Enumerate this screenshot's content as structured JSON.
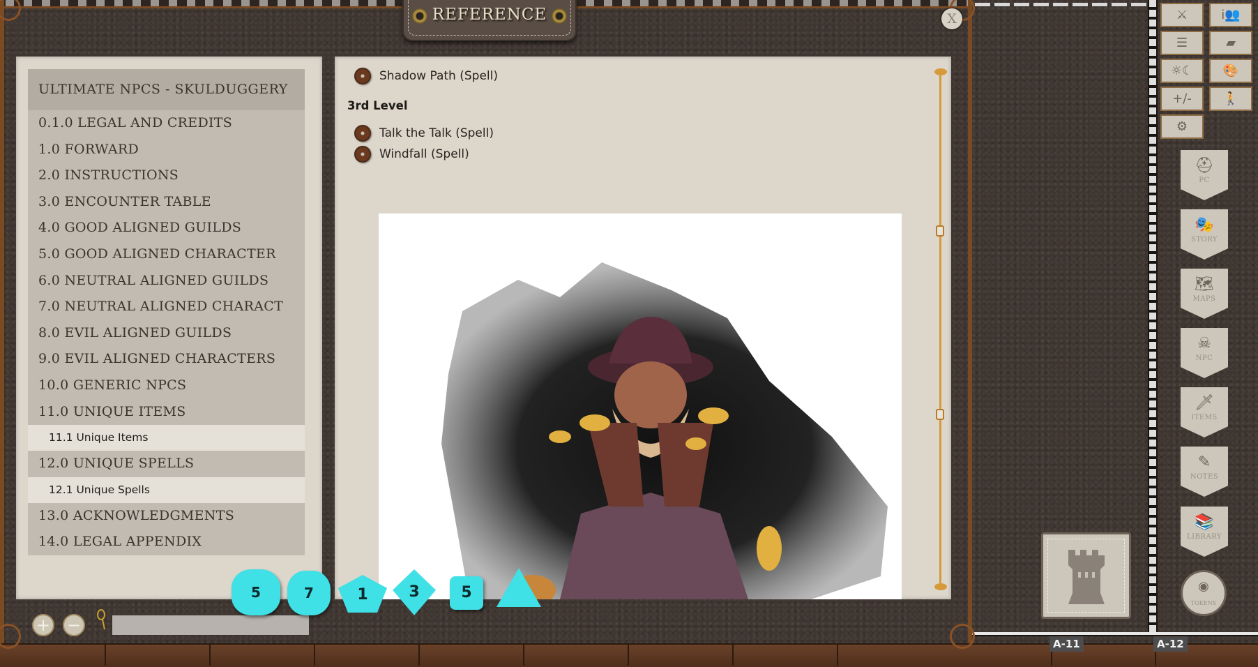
{
  "window": {
    "title": "REFERENCE",
    "close_label": "X"
  },
  "toc": {
    "header": "ULTIMATE NPCS - SKULDUGGERY",
    "chapters": [
      {
        "label": "0.1.0 LEGAL AND CREDITS"
      },
      {
        "label": "1.0 FORWARD"
      },
      {
        "label": "2.0 INSTRUCTIONS"
      },
      {
        "label": "3.0 ENCOUNTER TABLE"
      },
      {
        "label": "4.0 GOOD ALIGNED GUILDS"
      },
      {
        "label": "5.0 GOOD ALIGNED CHARACTER"
      },
      {
        "label": "6.0 NEUTRAL ALIGNED GUILDS"
      },
      {
        "label": "7.0 NEUTRAL ALIGNED CHARACT"
      },
      {
        "label": "8.0 EVIL ALIGNED GUILDS"
      },
      {
        "label": "9.0 EVIL ALIGNED CHARACTERS"
      },
      {
        "label": "10.0 GENERIC NPCS"
      },
      {
        "label": "11.0 UNIQUE ITEMS",
        "sub": "11.1 Unique Items"
      },
      {
        "label": "12.0 UNIQUE SPELLS",
        "sub": "12.1 Unique Spells"
      },
      {
        "label": "13.0 ACKNOWLEDGMENTS"
      },
      {
        "label": "14.0 LEGAL APPENDIX"
      }
    ]
  },
  "content": {
    "links_top": [
      {
        "label": "Shadow Path (Spell)",
        "icon": "link-icon"
      }
    ],
    "heading": "3rd Level",
    "links_bottom": [
      {
        "label": "Talk the Talk (Spell)",
        "icon": "link-icon"
      },
      {
        "label": "Windfall (Spell)",
        "icon": "link-icon"
      }
    ],
    "image_description": "Illustration of an old bearded man in a wide-brimmed hat tossing gold coins over an ink splash"
  },
  "bottom_controls": {
    "zoom_in_label": "+",
    "zoom_out_label": "−",
    "search_icon": "magnifier-icon",
    "search_value": "",
    "search_placeholder": ""
  },
  "dice": [
    {
      "type": "d20",
      "face": "5"
    },
    {
      "type": "d12",
      "face": "7"
    },
    {
      "type": "d10",
      "face": "1"
    },
    {
      "type": "d8",
      "face": "3"
    },
    {
      "type": "d6",
      "face": "5"
    },
    {
      "type": "d4",
      "face": ""
    }
  ],
  "sidebar": {
    "grid_buttons": [
      {
        "name": "combat-tracker",
        "glyph": "⚔"
      },
      {
        "name": "party-sheet",
        "glyph": "i👥"
      },
      {
        "name": "options-list",
        "glyph": "☰"
      },
      {
        "name": "tables",
        "glyph": "▰"
      },
      {
        "name": "calendar",
        "glyph": "☼☾"
      },
      {
        "name": "colors",
        "glyph": "🎨"
      },
      {
        "name": "modifiers",
        "glyph": "+/-"
      },
      {
        "name": "effects",
        "glyph": "🚶"
      },
      {
        "name": "settings",
        "glyph": "⚙"
      }
    ],
    "shields": [
      {
        "label": "PC",
        "glyph": "⛑"
      },
      {
        "label": "STORY",
        "glyph": "🎭"
      },
      {
        "label": "MAPS",
        "glyph": "🗺"
      },
      {
        "label": "NPC",
        "glyph": "☠"
      },
      {
        "label": "ITEMS",
        "glyph": "🗡"
      },
      {
        "label": "NOTES",
        "glyph": "✎"
      },
      {
        "label": "LIBRARY",
        "glyph": "📚"
      }
    ],
    "tokens_label": "TOKENS",
    "tower_label": "tower"
  },
  "grid_labels": [
    "A-11",
    "A-12"
  ]
}
